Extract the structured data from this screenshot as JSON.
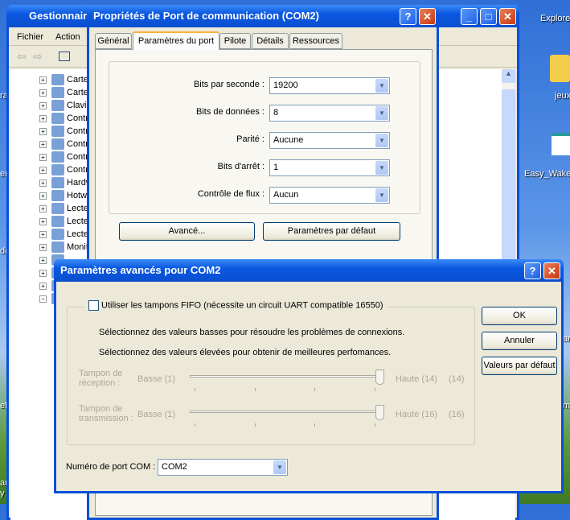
{
  "desktop": {
    "left_labels": [
      "ra",
      "er",
      "de",
      "efox",
      "arch &",
      "y"
    ],
    "right_labels": [
      "Explore",
      "jeux",
      "Easy_Wake",
      "art",
      "mo"
    ]
  },
  "device_manager": {
    "title": "Gestionnaire",
    "menu": [
      "Fichier",
      "Action"
    ],
    "tree": [
      {
        "sign": "+",
        "label": "Cartes"
      },
      {
        "sign": "+",
        "label": "Cartes"
      },
      {
        "sign": "+",
        "label": "Claviers"
      },
      {
        "sign": "+",
        "label": "Contrôl"
      },
      {
        "sign": "+",
        "label": "Contrôl"
      },
      {
        "sign": "+",
        "label": "Contrôl"
      },
      {
        "sign": "+",
        "label": "Contrôl"
      },
      {
        "sign": "+",
        "label": "Contrôl"
      },
      {
        "sign": "+",
        "label": "Hardwa"
      },
      {
        "sign": "+",
        "label": "Hotwire"
      },
      {
        "sign": "+",
        "label": "Lecteur"
      },
      {
        "sign": "+",
        "label": "Lecteur"
      },
      {
        "sign": "+",
        "label": "Lecteur"
      },
      {
        "sign": "+",
        "label": "Moniteu"
      },
      {
        "sign": "+",
        "label": ""
      },
      {
        "sign": "+",
        "label": ""
      },
      {
        "sign": "+",
        "label": ""
      },
      {
        "sign": "−",
        "label": ""
      }
    ]
  },
  "properties": {
    "title": "Propriétés de Port de communication (COM2)",
    "tabs": [
      "Général",
      "Paramètres du port",
      "Pilote",
      "Détails",
      "Ressources"
    ],
    "active_tab": 1,
    "fields": [
      {
        "label": "Bits par seconde :",
        "value": "19200"
      },
      {
        "label": "Bits de données :",
        "value": "8"
      },
      {
        "label": "Parité :",
        "value": "Aucune"
      },
      {
        "label": "Bits d'arrêt :",
        "value": "1"
      },
      {
        "label": "Contrôle de flux :",
        "value": "Aucun"
      }
    ],
    "advanced_button": "Avancé...",
    "defaults_button": "Paramètres par défaut"
  },
  "advanced": {
    "title": "Paramètres avancés pour COM2",
    "fifo_label": "Utiliser les tampons FIFO (nécessite un circuit UART compatible 16550)",
    "fifo_checked": false,
    "hint1": "Sélectionnez des valeurs basses pour résoudre les problèmes de connexions.",
    "hint2": "Sélectionnez des valeurs élevées pour obtenir de meilleures perfomances.",
    "receive": {
      "label1": "Tampon de",
      "label2": "réception :",
      "low": "Basse (1)",
      "high": "Haute (14)",
      "value": "(14)",
      "fraction": 1.0
    },
    "transmit": {
      "label1": "Tampon de",
      "label2": "transmission :",
      "low": "Basse (1)",
      "high": "Haute (16)",
      "value": "(16)",
      "fraction": 1.0
    },
    "port_label": "Numéro de port COM :",
    "port_value": "COM2",
    "ok": "OK",
    "cancel": "Annuler",
    "defaults": "Valeurs par défaut"
  }
}
